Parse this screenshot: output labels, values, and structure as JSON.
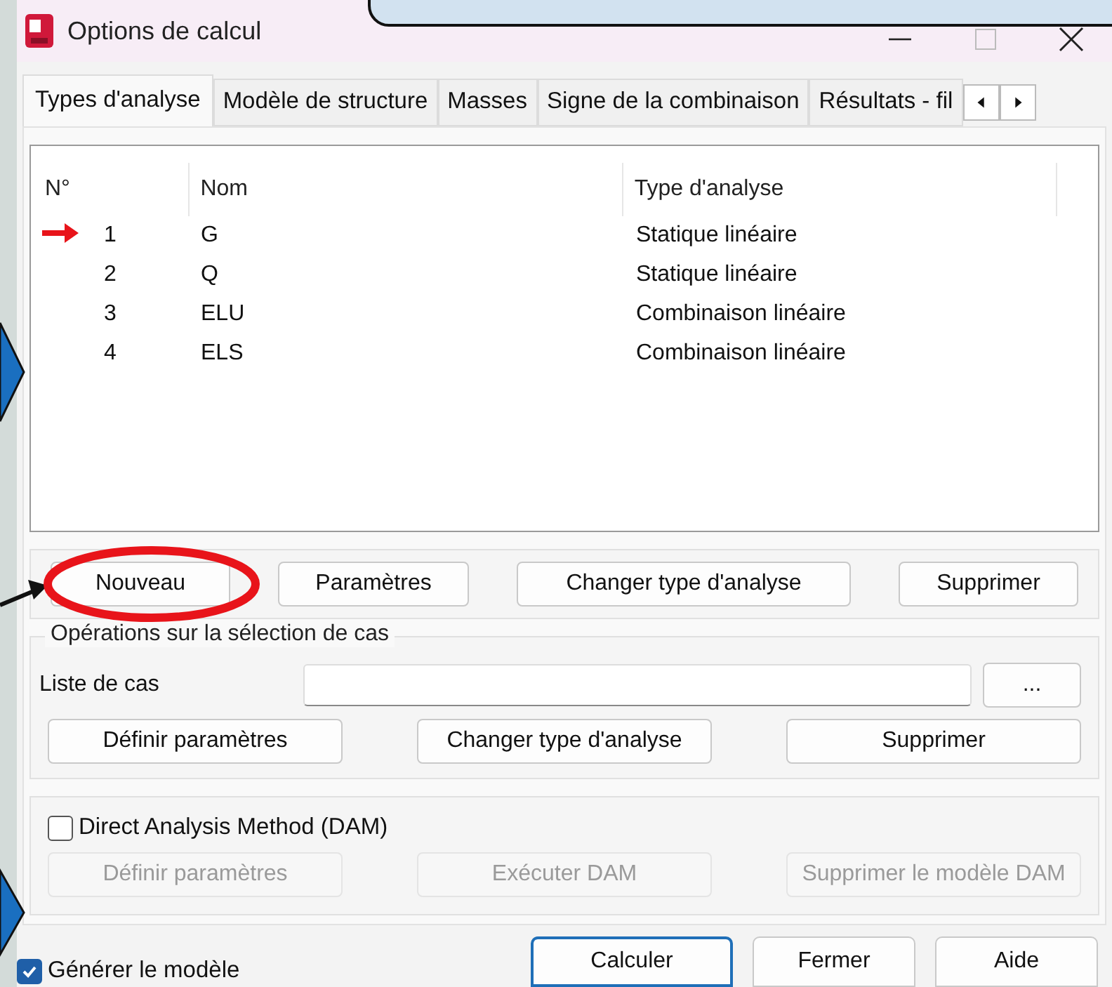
{
  "window": {
    "title": "Options de calcul"
  },
  "tabs": [
    {
      "label": "Types d'analyse",
      "selected": true
    },
    {
      "label": "Modèle de structure",
      "selected": false
    },
    {
      "label": "Masses",
      "selected": false
    },
    {
      "label": "Signe de la combinaison",
      "selected": false
    },
    {
      "label": "Résultats - fil",
      "selected": false
    }
  ],
  "table": {
    "columns": [
      "N°",
      "Nom",
      "Type d'analyse"
    ],
    "rows": [
      {
        "number": "1",
        "name": "G",
        "type": "Statique linéaire",
        "current": true
      },
      {
        "number": "2",
        "name": "Q",
        "type": "Statique linéaire",
        "current": false
      },
      {
        "number": "3",
        "name": "ELU",
        "type": "Combinaison linéaire",
        "current": false
      },
      {
        "number": "4",
        "name": "ELS",
        "type": "Combinaison linéaire",
        "current": false
      }
    ]
  },
  "case_buttons": [
    {
      "label": "Nouveau",
      "disabled": false
    },
    {
      "label": "Paramètres",
      "disabled": false
    },
    {
      "label": "Changer type d'analyse",
      "disabled": false
    },
    {
      "label": "Supprimer",
      "disabled": false
    }
  ],
  "selection_group": {
    "title": "Opérations sur la sélection de cas",
    "field_label": "Liste de cas",
    "browse_button": "...",
    "buttons": [
      {
        "label": "Définir paramètres",
        "disabled": false
      },
      {
        "label": "Changer type d'analyse",
        "disabled": false
      },
      {
        "label": "Supprimer",
        "disabled": false
      }
    ]
  },
  "dam_group": {
    "checkbox": {
      "label": "Direct Analysis Method (DAM)",
      "checked": false
    },
    "buttons": [
      {
        "label": "Définir paramètres",
        "disabled": true
      },
      {
        "label": "Exécuter DAM",
        "disabled": true
      },
      {
        "label": "Supprimer le modèle DAM",
        "disabled": true
      }
    ]
  },
  "footer": {
    "checkbox": {
      "label": "Générer le modèle",
      "checked": true
    },
    "buttons": [
      {
        "label": "Calculer",
        "default": true
      },
      {
        "label": "Fermer",
        "default": false
      },
      {
        "label": "Aide",
        "default": false
      }
    ]
  }
}
